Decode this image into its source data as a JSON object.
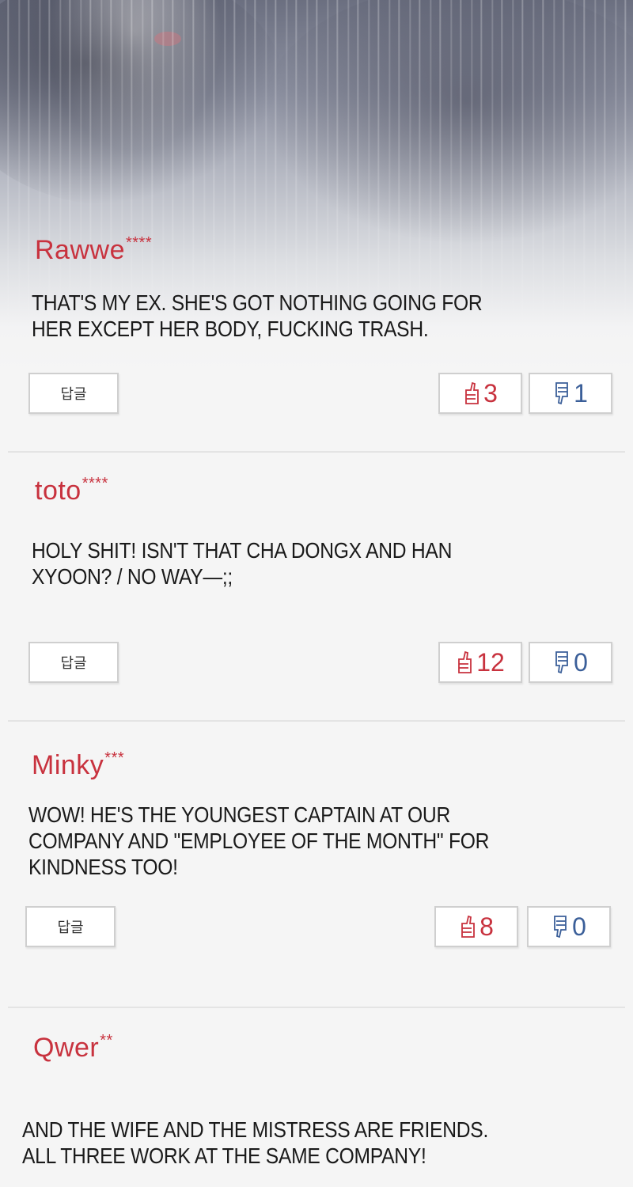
{
  "reply_label": "답글",
  "colors": {
    "username": "#c8323e",
    "like": "#c8323e",
    "dislike": "#3b5f99"
  },
  "comments": [
    {
      "username": "Rawwe",
      "stars": "****",
      "text": "THAT'S MY EX. SHE'S GOT NOTHING GOING FOR HER EXCEPT HER BODY, FUCKING TRASH.",
      "likes": "3",
      "dislikes": "1"
    },
    {
      "username": "toto",
      "stars": "****",
      "text": "HOLY SHIT! ISN'T THAT CHA DONGX AND HAN XYOON? / NO WAY—;;",
      "likes": "12",
      "dislikes": "0"
    },
    {
      "username": "Minky",
      "stars": "***",
      "text": "WOW! HE'S THE YOUNGEST CAPTAIN AT OUR COMPANY AND \"EMPLOYEE OF THE MONTH\" FOR KINDNESS TOO!",
      "likes": "8",
      "dislikes": "0"
    },
    {
      "username": "Qwer",
      "stars": "**",
      "text": "AND THE WIFE AND THE MISTRESS ARE FRIENDS. ALL THREE WORK AT THE SAME COMPANY!"
    }
  ]
}
